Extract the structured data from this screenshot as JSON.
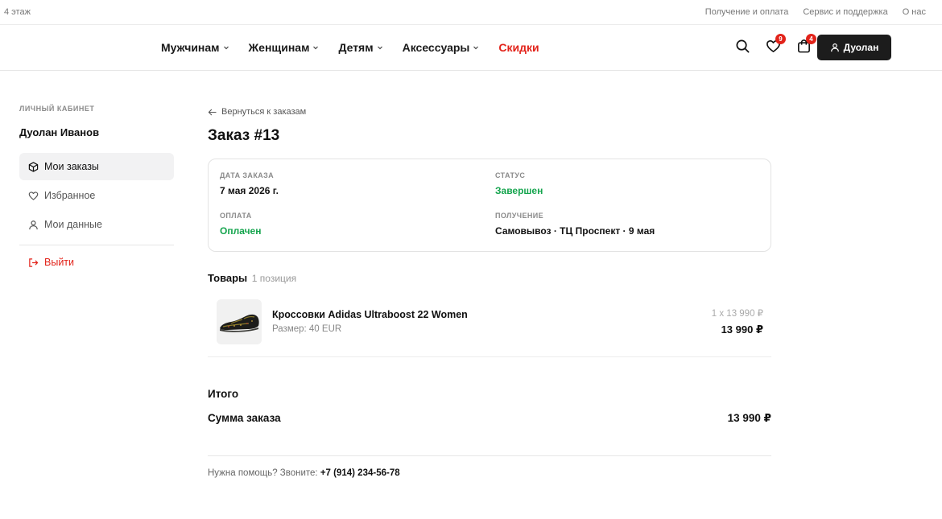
{
  "topbar": {
    "brand": "4 этаж",
    "links": [
      "Получение и оплата",
      "Сервис и поддержка",
      "О нас"
    ]
  },
  "nav": {
    "menu": [
      {
        "label": "Мужчинам",
        "has_dropdown": true
      },
      {
        "label": "Женщинам",
        "has_dropdown": true
      },
      {
        "label": "Детям",
        "has_dropdown": true
      },
      {
        "label": "Аксессуары",
        "has_dropdown": true
      }
    ],
    "sale": "Скидки",
    "icons": [
      "search-icon",
      "heart-icon",
      "bag-icon"
    ],
    "favorites_count": "9",
    "cart_count": "4",
    "user_button": "Дуолан",
    "colors": {
      "accent": "#e2231a",
      "dark_button": "#1c1c1c"
    }
  },
  "sidebar": {
    "section_label": "ЛИЧНЫЙ КАБИНЕТ",
    "user_name": "Дуолан Иванов",
    "items": [
      {
        "label": "Мои заказы",
        "icon": "box-icon",
        "active": true
      },
      {
        "label": "Избранное",
        "icon": "heart-icon",
        "active": false
      },
      {
        "label": "Мои данные",
        "icon": "user-icon",
        "active": false
      }
    ],
    "logout": "Выйти"
  },
  "order": {
    "back_link": "Вернуться к заказам",
    "title": "Заказ #13",
    "date_label": "ДАТА ЗАКАЗА",
    "date_value": "7 мая 2026 г.",
    "status_label": "СТАТУС",
    "status_value": "Завершен",
    "payment_label": "ОПЛАТА",
    "payment_value": "Оплачен",
    "delivery_label": "ПОЛУЧЕНИЕ",
    "delivery_value": "Самовывоз · ТЦ Проспект · 9 мая",
    "status_color": "#14a44d"
  },
  "goods": {
    "title": "Товары",
    "count": "1 позиция",
    "items": [
      {
        "name": "Кроссовки Adidas Ultraboost 22 Women",
        "size": "Размер: 40 EUR",
        "unit_price": "1 x 13 990 ₽",
        "total": "13 990 ₽"
      }
    ]
  },
  "totals": {
    "title": "Итого",
    "sum_label": "Сумма заказа",
    "sum_value": "13 990 ₽"
  },
  "help": {
    "text": "Нужна помощь? Звоните:",
    "phone": "+7 (914) 234-56-78"
  }
}
